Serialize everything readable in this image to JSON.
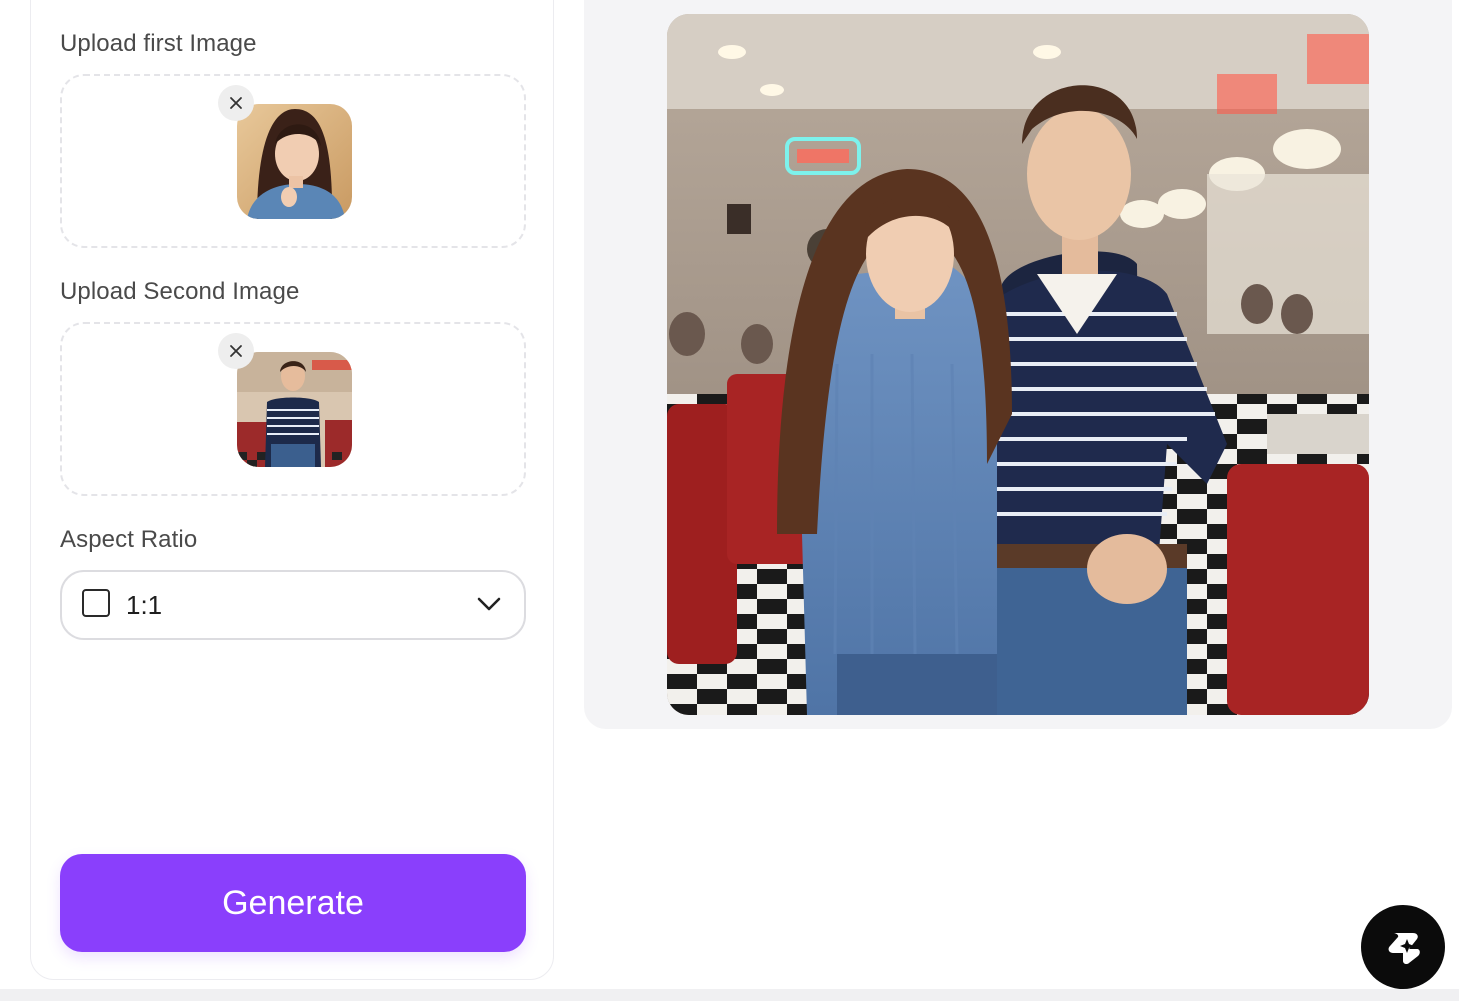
{
  "form": {
    "first_image_label": "Upload first Image",
    "second_image_label": "Upload Second Image",
    "aspect_ratio_label": "Aspect Ratio",
    "aspect_ratio_value": "1:1",
    "generate_label": "Generate"
  },
  "colors": {
    "accent": "#8a3ffc",
    "preview_bg": "#f4f4f6",
    "fab_bg": "#0b0b0b"
  },
  "icons": {
    "remove": "close-icon",
    "dropdown": "chevron-down-icon",
    "ratio": "square-ratio-icon",
    "assistant": "sparkle-assistant-icon"
  }
}
